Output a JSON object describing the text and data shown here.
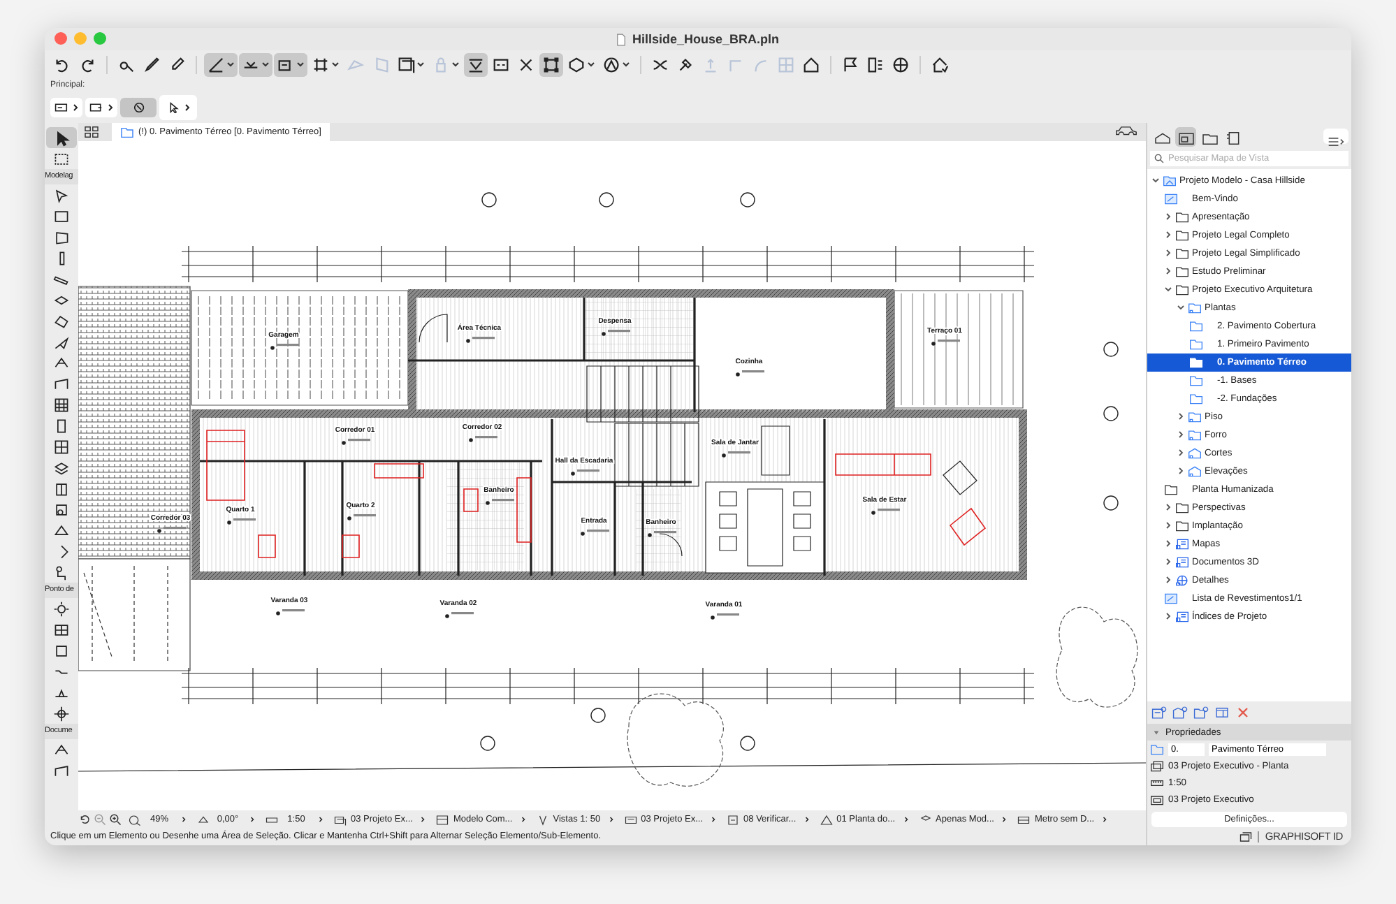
{
  "window": {
    "title": "Hillside_House_BRA.pln"
  },
  "toolbar": [
    [
      {
        "on": false,
        "disabled": false
      },
      {
        "on": false,
        "disabled": false
      }
    ],
    [
      {
        "on": false,
        "disabled": false
      },
      {
        "on": false,
        "disabled": false
      },
      {
        "on": false,
        "disabled": false
      }
    ],
    [
      {
        "on": true,
        "disabled": false
      },
      {
        "on": true,
        "disabled": false
      },
      {
        "on": true,
        "disabled": false
      },
      {
        "on": false,
        "disabled": false
      },
      {
        "on": false,
        "disabled": true
      },
      {
        "on": false,
        "disabled": true
      },
      {
        "on": false,
        "disabled": false
      },
      {
        "on": false,
        "disabled": true
      },
      {
        "on": true,
        "disabled": false
      },
      {
        "on": false,
        "disabled": false
      },
      {
        "on": false,
        "disabled": false
      },
      {
        "on": true,
        "disabled": false
      },
      {
        "on": false,
        "disabled": false
      },
      {
        "on": false,
        "disabled": false
      }
    ],
    [
      {
        "on": false,
        "disabled": false
      },
      {
        "on": false,
        "disabled": false
      },
      {
        "on": false,
        "disabled": true
      },
      {
        "on": false,
        "disabled": true
      },
      {
        "on": false,
        "disabled": true
      },
      {
        "on": false,
        "disabled": true
      },
      {
        "on": false,
        "disabled": false
      }
    ],
    [
      {
        "on": false,
        "disabled": false
      },
      {
        "on": false,
        "disabled": false
      },
      {
        "on": false,
        "disabled": false
      }
    ],
    [
      {
        "on": false,
        "disabled": false
      }
    ]
  ],
  "info_box": {
    "label": "Principal:",
    "controls": [
      {
        "on": false
      },
      {
        "on": false
      },
      {
        "on": true
      },
      {
        "on": false
      }
    ]
  },
  "view_tab": {
    "label": "(!) 0. Pavimento Térreo [0. Pavimento Térreo]"
  },
  "toolbox": {
    "top": [
      {
        "selected": true
      },
      {
        "selected": false
      }
    ],
    "sections": [
      {
        "label": "Modelag",
        "tools": [
          {
            "selected": false
          },
          {
            "selected": false
          },
          {
            "selected": false
          },
          {
            "selected": false
          },
          {
            "selected": false
          },
          {
            "selected": false
          },
          {
            "selected": false
          },
          {
            "selected": false
          },
          {
            "selected": false
          },
          {
            "selected": false
          },
          {
            "selected": false
          },
          {
            "selected": false
          },
          {
            "selected": false
          },
          {
            "selected": false
          },
          {
            "selected": false
          },
          {
            "selected": false
          },
          {
            "selected": false
          },
          {
            "selected": false
          },
          {
            "selected": false
          }
        ]
      },
      {
        "label": "Ponto de",
        "tools": [
          {
            "selected": false
          },
          {
            "selected": false
          },
          {
            "selected": false
          },
          {
            "selected": false
          },
          {
            "selected": false
          },
          {
            "selected": false
          }
        ]
      },
      {
        "label": "Docume",
        "tools": [
          {
            "selected": false
          },
          {
            "selected": false
          }
        ]
      }
    ]
  },
  "plan": {
    "rooms": [
      "Garagem",
      "Área Técnica",
      "Despensa",
      "Terraço 01",
      "Cozinha",
      "Corredor 01",
      "Corredor 02",
      "Sala de Jantar",
      "Hall da Escadaria",
      "Banheiro",
      "Sala de Estar",
      "Quarto 1",
      "Quarto 2",
      "Entrada",
      "Banheiro",
      "Corredor 03",
      "Varanda 03",
      "Varanda 02",
      "Varanda 01"
    ]
  },
  "navigator_bar": [
    "49%",
    "0,00°",
    "1:50",
    "03 Projeto Ex...",
    "Modelo Com...",
    "Vistas 1: 50",
    "03 Projeto Ex...",
    "08 Verificar...",
    "01 Planta do...",
    "Apenas Mod...",
    "Metro sem D..."
  ],
  "status_message": "Clique em um Elemento ou Desenhe uma Área de Seleção. Clicar e Mantenha Ctrl+Shift para Alternar Seleção Elemento/Sub-Elemento.",
  "right_panel": {
    "tabs": [
      {
        "selected": false
      },
      {
        "selected": true
      },
      {
        "selected": false
      },
      {
        "selected": false
      }
    ],
    "search": {
      "placeholder": "Pesquisar Mapa de Vista"
    },
    "tree": [
      {
        "label": "Projeto Modelo - Casa Hillside",
        "kind": "project",
        "expanded": true,
        "selected": false,
        "children": [
          {
            "label": "Bem-Vindo",
            "kind": "page",
            "selected": false
          },
          {
            "label": "Apresentação",
            "kind": "folder",
            "expanded": false,
            "selected": false
          },
          {
            "label": "Projeto Legal Completo",
            "kind": "folder",
            "expanded": false,
            "selected": false
          },
          {
            "label": "Projeto Legal Simplificado",
            "kind": "folder",
            "expanded": false,
            "selected": false
          },
          {
            "label": "Estudo Preliminar",
            "kind": "folder",
            "expanded": false,
            "selected": false
          },
          {
            "label": "Projeto Executivo Arquitetura",
            "kind": "folder",
            "expanded": true,
            "selected": false,
            "children": [
              {
                "label": "Plantas",
                "kind": "view-folder",
                "expanded": true,
                "selected": false,
                "children": [
                  {
                    "label": "2. Pavimento Cobertura",
                    "kind": "story",
                    "selected": false
                  },
                  {
                    "label": "1. Primeiro Pavimento",
                    "kind": "story",
                    "selected": false
                  },
                  {
                    "label": "0. Pavimento Térreo",
                    "kind": "story",
                    "selected": true
                  },
                  {
                    "label": "-1. Bases",
                    "kind": "story",
                    "selected": false
                  },
                  {
                    "label": "-2. Fundações",
                    "kind": "story",
                    "selected": false
                  }
                ]
              },
              {
                "label": "Piso",
                "kind": "view-folder",
                "expanded": false,
                "selected": false
              },
              {
                "label": "Forro",
                "kind": "view-folder",
                "expanded": false,
                "selected": false
              },
              {
                "label": "Cortes",
                "kind": "section-folder",
                "expanded": false,
                "selected": false
              },
              {
                "label": "Elevações",
                "kind": "section-folder",
                "expanded": false,
                "selected": false
              }
            ]
          },
          {
            "label": "Planta Humanizada",
            "kind": "folder",
            "selected": false
          },
          {
            "label": "Perspectivas",
            "kind": "folder",
            "expanded": false,
            "selected": false
          },
          {
            "label": "Implantação",
            "kind": "folder",
            "expanded": false,
            "selected": false
          },
          {
            "label": "Mapas",
            "kind": "sheet",
            "expanded": false,
            "selected": false
          },
          {
            "label": "Documentos 3D",
            "kind": "sheet",
            "expanded": false,
            "selected": false
          },
          {
            "label": "Detalhes",
            "kind": "globe",
            "expanded": false,
            "selected": false
          },
          {
            "label": "Lista de Revestimentos1/1",
            "kind": "page",
            "selected": false
          },
          {
            "label": "Índices de Projeto",
            "kind": "sheet",
            "expanded": false,
            "selected": false
          }
        ]
      }
    ],
    "properties": {
      "title": "Propriedades",
      "id_value": "0.",
      "name_value": "Pavimento Térreo",
      "rows": [
        "03 Projeto Executivo - Planta",
        "1:50",
        "03 Projeto Executivo"
      ],
      "button": "Definições..."
    },
    "footer": {
      "account": "GRAPHISOFT ID"
    }
  }
}
